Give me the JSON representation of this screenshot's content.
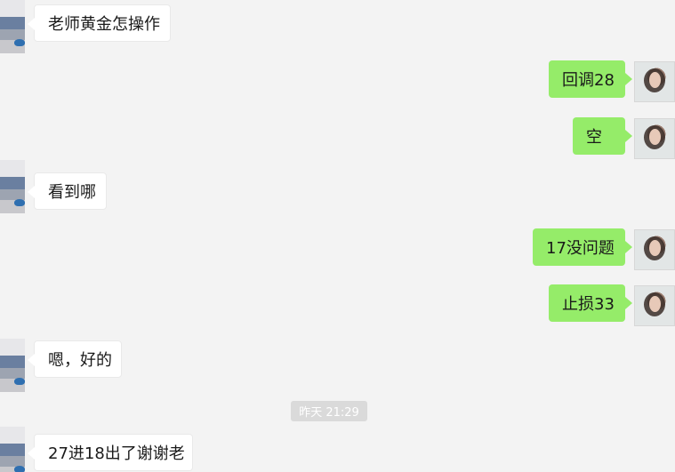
{
  "chat": {
    "messages": [
      {
        "side": "left",
        "text": "老师黄金怎操作"
      },
      {
        "side": "right",
        "text": "回调28"
      },
      {
        "side": "right",
        "text": "空"
      },
      {
        "side": "left",
        "text": "看到哪"
      },
      {
        "side": "right",
        "text": "17没问题"
      },
      {
        "side": "right",
        "text": "止损33"
      },
      {
        "side": "left",
        "text": "嗯，好的"
      },
      {
        "side": "left",
        "text": "27进18出了谢谢老"
      }
    ],
    "timestamp": "昨天 21:29"
  },
  "colors": {
    "background": "#f3f3f3",
    "incoming_bubble": "#ffffff",
    "outgoing_bubble": "#95ec69",
    "timestamp_bg": "#dadada"
  }
}
